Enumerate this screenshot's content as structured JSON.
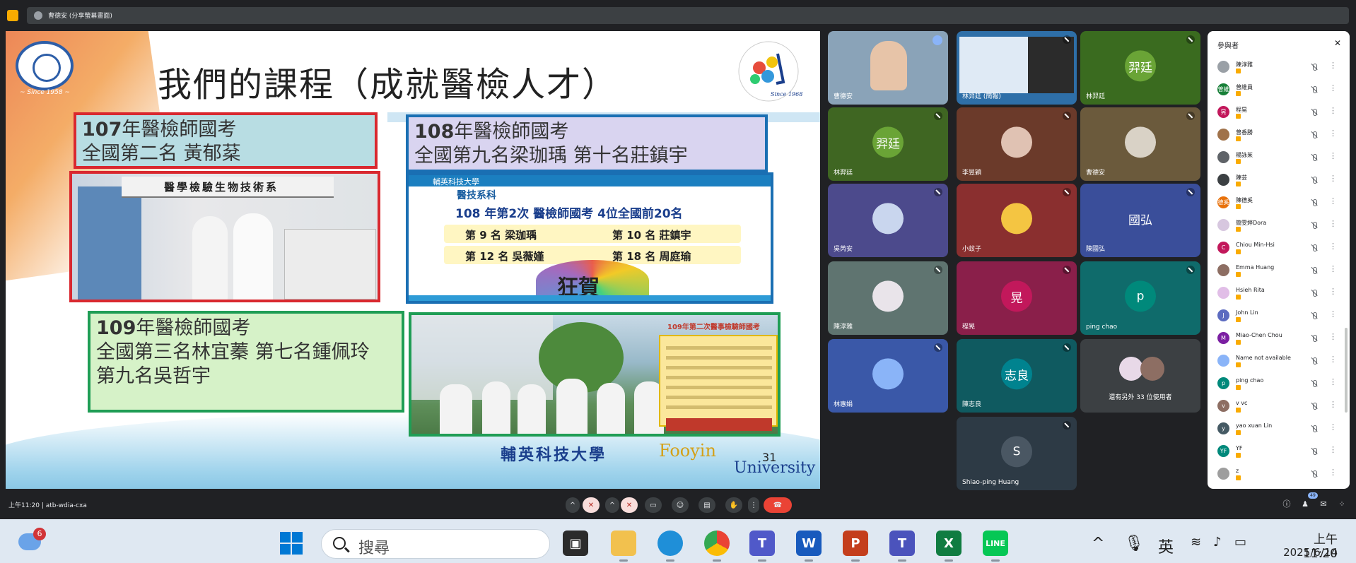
{
  "window": {
    "tab_title": "曹德安 (分享螢幕畫面)"
  },
  "slide": {
    "title": "我們的課程（成就醫檢人才）",
    "seal_year": "~ Since 1958 ~",
    "dept_logo": "Department of Medical Laboratory Science and Biotechnology",
    "box_107": {
      "year": "107",
      "title": "年醫檢師國考",
      "line": "全國第二名  黃郁棻"
    },
    "box_108": {
      "year": "108",
      "title": "年醫檢師國考",
      "line": "全國第九名梁珈瑀 第十名莊鎮宇"
    },
    "box_109": {
      "year": "109",
      "title": "年醫檢師國考",
      "line1": "全國第三名林宜蓁 第七名鍾佩玲",
      "line2": "第九名吳哲宇"
    },
    "photo1_banner": "醫學檢驗生物技術系",
    "photo2": {
      "top": "輔英科技大學",
      "head": "醫技系科",
      "headline": "108 年第2次 醫檢師國考 4位全國前20名",
      "rows": [
        {
          "a": "第 9 名 梁珈瑀",
          "b": "第 10 名 莊鎮宇"
        },
        {
          "a": "第 12 名 吳薇嫤",
          "b": "第 18 名 周庭瑜"
        }
      ],
      "celebrate": "狂賀"
    },
    "photo3_card_title": "109年第二次醫事檢驗師國考",
    "footer_school": "輔英科技大學",
    "footer_fooyin": "Fooyin",
    "footer_university": "University",
    "page_number": "31"
  },
  "tiles": [
    {
      "name": "曹德安",
      "type": "video",
      "bg": "#8aa3b8"
    },
    {
      "name": "林羿廷 (簡報)",
      "type": "screen",
      "bg": "#2e6fa8"
    },
    {
      "name": "林羿廷",
      "type": "initials",
      "initials": "羿廷",
      "bg": "#3a6b1f",
      "av": "#6aa436"
    },
    {
      "name": "林羿廷",
      "type": "initials",
      "initials": "羿廷",
      "bg": "#3f6622",
      "av": "#6aa436"
    },
    {
      "name": "李昱穎",
      "type": "photo",
      "bg": "#6b3a2a",
      "av": "#e0c2b3"
    },
    {
      "name": "曹德安",
      "type": "photo",
      "bg": "#6b5a3c",
      "av": "#d9d2c6"
    },
    {
      "name": "吳芮安",
      "type": "photo",
      "bg": "#4c4a8c",
      "av": "#c9d6ee"
    },
    {
      "name": "小蚊子",
      "type": "photo",
      "bg": "#8a2f2f",
      "av": "#f4c542"
    },
    {
      "name": "陳國弘",
      "type": "initials",
      "initials": "國弘",
      "bg": "#3a4e9a",
      "av": "#3a4e9a"
    },
    {
      "name": "陳淳雅",
      "type": "photo",
      "bg": "#5f7470",
      "av": "#e9e4ea"
    },
    {
      "name": "程晃",
      "type": "initials",
      "initials": "晃",
      "bg": "#8a1f4a",
      "av": "#c2185b"
    },
    {
      "name": "ping chao",
      "type": "initials",
      "initials": "p",
      "bg": "#0f6b6b",
      "av": "#00897b"
    },
    {
      "name": "林惠娟",
      "type": "default",
      "bg": "#3a58a8",
      "av": "#8ab4f8"
    },
    {
      "name": "陳志良",
      "type": "initials",
      "initials": "志良",
      "bg": "#0f5a60",
      "av": "#00838f"
    },
    {
      "name": "還有另外 33 位使用者",
      "type": "others",
      "bg": "#3c4043",
      "av": "#e8d9e8"
    },
    {
      "name": "Shiao-ping Huang",
      "type": "initials",
      "initials": "S",
      "bg": "#2d3a45",
      "av": "#4a5763"
    }
  ],
  "panel": {
    "title": "參與者",
    "rows": [
      {
        "name": "陳淳雅",
        "color": "#9aa0a6",
        "initial": ""
      },
      {
        "name": "曾維員",
        "color": "#188038",
        "initial": "曾維"
      },
      {
        "name": "程晃",
        "color": "#c2185b",
        "initial": "晃"
      },
      {
        "name": "曾香勝",
        "color": "#a0724a",
        "initial": ""
      },
      {
        "name": "楊詠茱",
        "color": "#5f6368",
        "initial": ""
      },
      {
        "name": "陳芸",
        "color": "#3c4043",
        "initial": ""
      },
      {
        "name": "陳德奚",
        "color": "#e8710a",
        "initial": "德奚"
      },
      {
        "name": "簡雯婷Dora",
        "color": "#d7c7df",
        "initial": ""
      },
      {
        "name": "Chiou Min-Hsi",
        "color": "#c2185b",
        "initial": "C"
      },
      {
        "name": "Emma Huang",
        "color": "#8d6e63",
        "initial": ""
      },
      {
        "name": "Hsieh Rita",
        "color": "#e1bee7",
        "initial": ""
      },
      {
        "name": "John Lin",
        "color": "#5c6bc0",
        "initial": "J"
      },
      {
        "name": "Miao-Chen Chou",
        "color": "#7b1fa2",
        "initial": "M"
      },
      {
        "name": "Name not available",
        "color": "#8ab4f8",
        "initial": ""
      },
      {
        "name": "ping chao",
        "color": "#00897b",
        "initial": "p"
      },
      {
        "name": "v vc",
        "color": "#8d6e63",
        "initial": "v"
      },
      {
        "name": "yao xuan Lin",
        "color": "#455a64",
        "initial": "y"
      },
      {
        "name": "YF",
        "color": "#00897b",
        "initial": "YF"
      },
      {
        "name": "z",
        "color": "#9e9e9e",
        "initial": ""
      }
    ]
  },
  "meeting_bar": {
    "time": "上午11:20",
    "separator": "|",
    "meeting_code": "atb-wdia-cxa",
    "participants_count": "49"
  },
  "taskbar": {
    "weather_badge": "6",
    "search_text": "搜尋",
    "ime": "英",
    "time": "上午 11:20",
    "date": "2025/6/14"
  }
}
